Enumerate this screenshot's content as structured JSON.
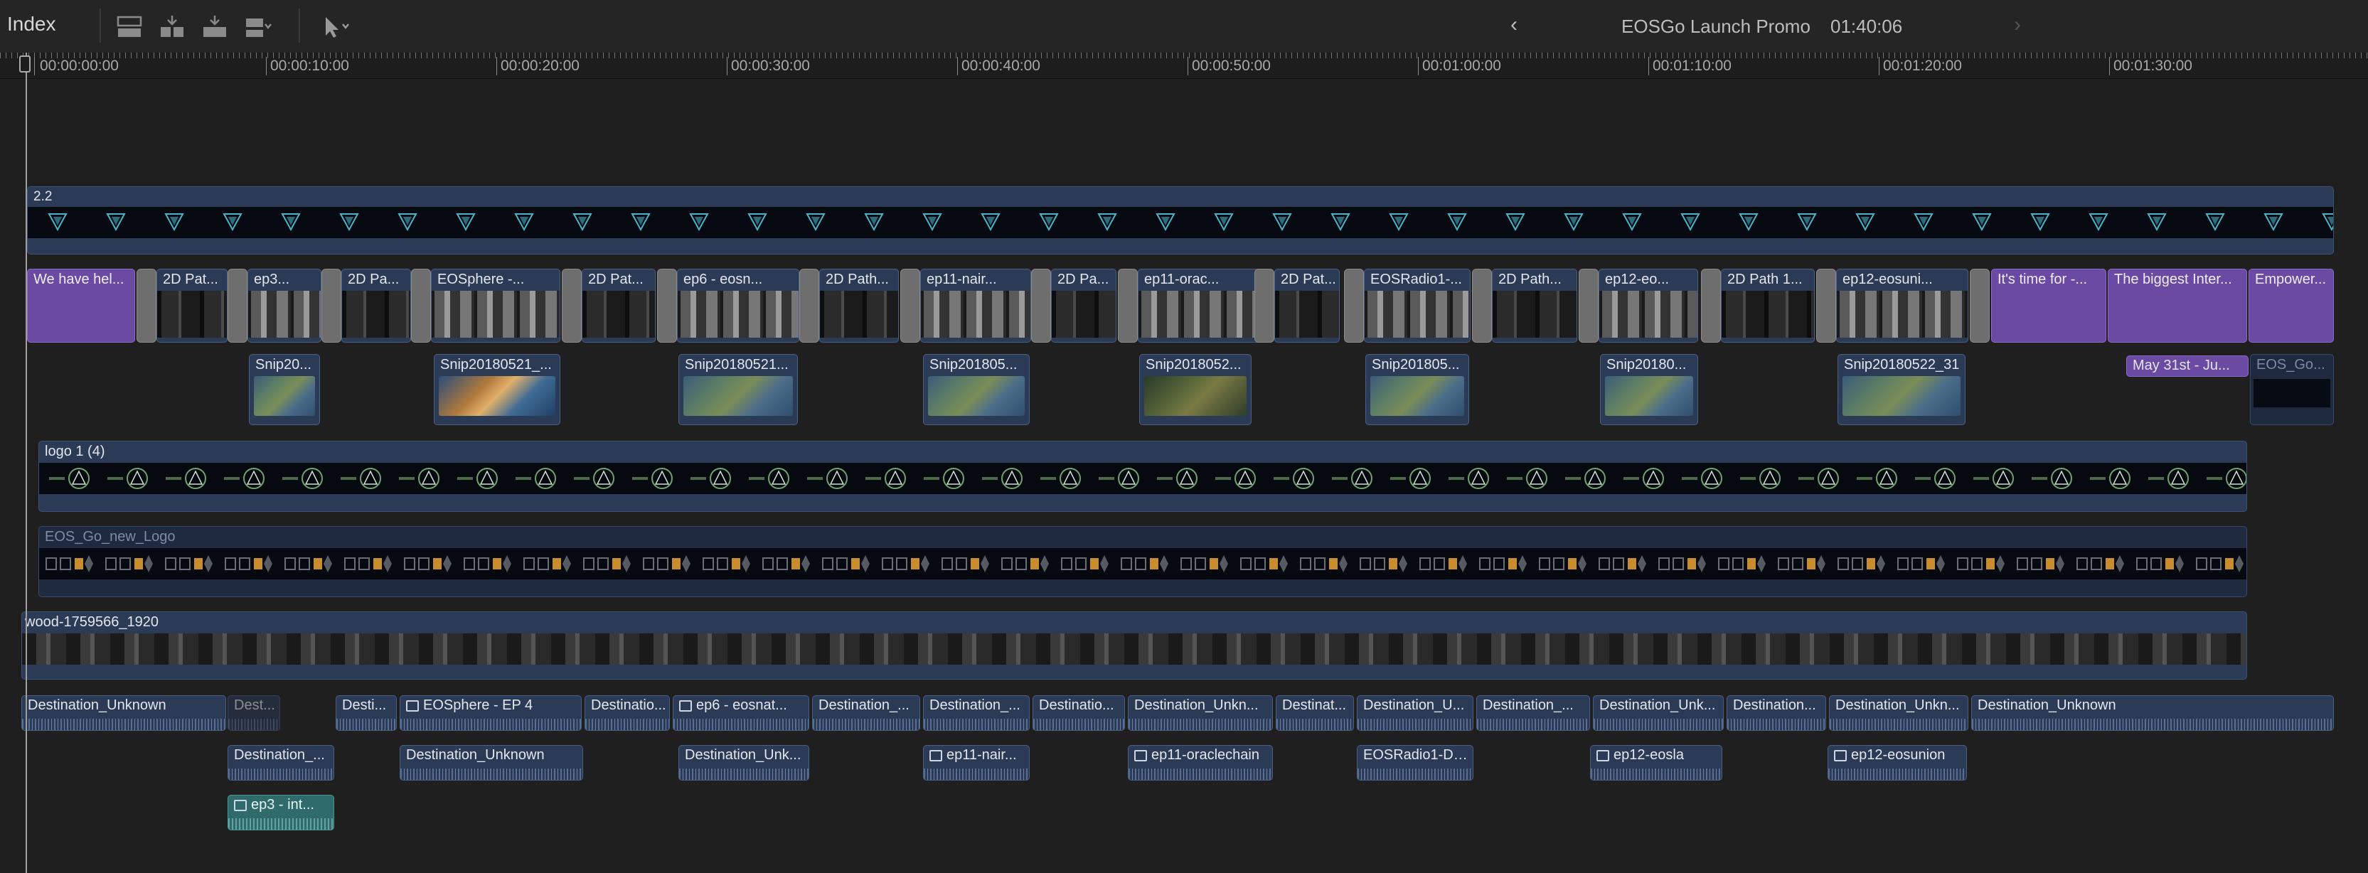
{
  "app": {
    "index_label": "Index",
    "project_title": "EOSGo Launch Promo",
    "project_duration": "01:40:06",
    "nav_back": "‹",
    "nav_forward": "›"
  },
  "toolbar": {
    "icons": [
      "append-clip-icon",
      "insert-clip-icon",
      "overwrite-clip-icon",
      "connect-clip-menu-icon",
      "select-tool-menu-icon"
    ]
  },
  "ruler": {
    "ticks": [
      "00:00:00:00",
      "00:00:10:00",
      "00:00:20:00",
      "00:00:30:00",
      "00:00:40:00",
      "00:00:50:00",
      "00:01:00:00",
      "00:01:10:00",
      "00:01:20:00",
      "00:01:30:00"
    ]
  },
  "lanes": {
    "top_layer_label": "2.2",
    "logo_lane_label": "logo 1 (4)",
    "eos_logo_label": "EOS_Go_new_Logo",
    "wood_label": "wood-1759566_1920"
  },
  "primary": {
    "titles": [
      "We have hel...",
      "It's time for -...",
      "The biggest Inter...",
      "Empower..."
    ],
    "clips": [
      "2D Pat...",
      "ep3...",
      "2D Pa...",
      "EOSphere -...",
      "2D Pat...",
      "ep6 - eosn...",
      "2D Path...",
      "ep11-nair...",
      "2D Pa...",
      "ep11-orac...",
      "2D Pat...",
      "EOSRadio1-...",
      "2D Path...",
      "ep12-eo...",
      "2D Path 1...",
      "ep12-eosuni..."
    ]
  },
  "snips": {
    "items": [
      "Snip20...",
      "Snip20180521_...",
      "Snip20180521...",
      "Snip201805...",
      "Snip2018052...",
      "Snip201805...",
      "Snip20180...",
      "Snip20180522_31"
    ],
    "may_title": "May 31st - Ju...",
    "eos_go_small": "EOS_Go..."
  },
  "audio": {
    "row1": [
      "Destination_Unknown",
      "Dest...",
      "Desti...",
      "EOSphere - EP 4",
      "Destinatio...",
      "ep6 - eosnat...",
      "Destination_...",
      "Destination_...",
      "Destinatio...",
      "Destination_Unkn...",
      "Destinat...",
      "Destination_U...",
      "Destination_...",
      "Destination_Unk...",
      "Destination...",
      "Destination_Unkn...",
      "Destination_Unknown"
    ],
    "row2": [
      "Destination_...",
      "Destination_Unknown",
      "Destination_Unk...",
      "ep11-nair...",
      "ep11-oraclechain",
      "EOSRadio1-Da...",
      "ep12-eosla",
      "ep12-eosunion"
    ],
    "row3": [
      "ep3 - int..."
    ]
  },
  "colors": {
    "background": "#1f1f1f",
    "clip_blue": "#2b3a55",
    "title_purple": "#6a4aa3",
    "audio_teal": "#2f6b6b",
    "transition_gray": "#6e6e6e"
  }
}
